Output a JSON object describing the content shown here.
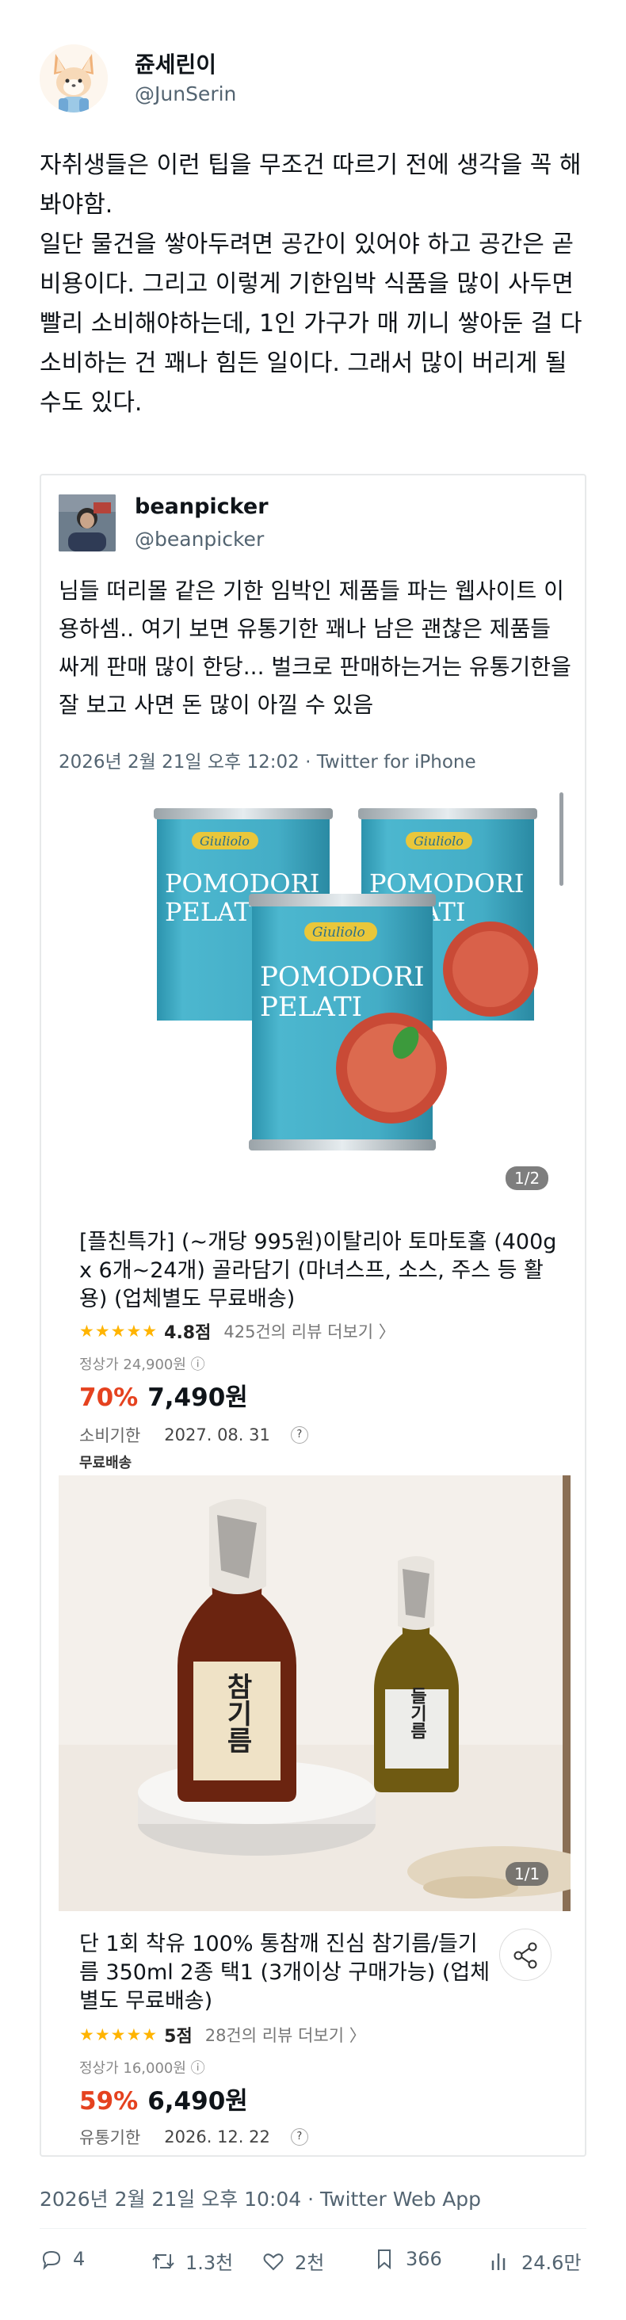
{
  "author": {
    "name": "쥰세린이",
    "handle": "@JunSerin"
  },
  "main_text": [
    "자취생들은 이런 팁을 무조건 따르기 전에 생각을 꼭 해봐야함.",
    "일단 물건을 쌓아두려면 공간이 있어야 하고 공간은 곧 비용이다. 그리고 이렇게 기한임박 식품을 많이 사두면 빨리 소비해야하는데, 1인 가구가 매 끼니 쌓아둔 걸 다 소비하는 건 꽤나 힘든 일이다. 그래서 많이 버리게 될 수도 있다."
  ],
  "quote": {
    "name": "beanpicker",
    "handle": "@beanpicker",
    "text": "님들 떠리몰 같은 기한 임박인 제품들 파는 웹사이트 이용하셈.. 여기 보면 유통기한 꽤나 남은 괜찮은 제품들 싸게 판매 많이 한당... 벌크로 판매하는거는 유통기한을 잘 보고 사면 돈 많이 아낄 수 있음",
    "date": "2026년 2월 21일 오후 12:02 · Twitter for iPhone"
  },
  "product1": {
    "can_brand": "Giuliolo",
    "can_label_line1": "POMODORI",
    "can_label_line2": "PELATI",
    "page_badge": "1/2",
    "title": "[플친특가] (~개당 995원)이탈리아 토마토홀 (400g x 6개~24개) 골라담기 (마녀스프, 소스, 주스 등 활용) (업체별도 무료배송)",
    "stars": "★★★★★",
    "rating": "4.8점",
    "reviews": "425건의 리뷰 더보기 〉",
    "list_price": "정상가 24,900원 ⓘ",
    "discount": "70%",
    "price": "7,490원",
    "expiry_label": "소비기한",
    "expiry_date": "2027. 08. 31",
    "help": "?",
    "free_shipping": "무료배송"
  },
  "product2": {
    "bottle1_label": "참기름",
    "bottle2_label": "들기름",
    "page_badge": "1/1",
    "title": "단 1회 착유 100% 통참깨 진심 참기름/들기름 350ml 2종 택1 (3개이상 구매가능) (업체별도 무료배송)",
    "stars": "★★★★★",
    "rating": "5점",
    "reviews": "28건의 리뷰 더보기 〉",
    "list_price": "정상가 16,000원 ⓘ",
    "discount": "59%",
    "price": "6,490원",
    "expiry_label": "유통기한",
    "expiry_date": "2026. 12. 22",
    "help": "?"
  },
  "post_date": "2026년 2월 21일 오후 10:04 · Twitter Web App",
  "actions": {
    "replies": "4",
    "retweets": "1.3천",
    "likes": "2천",
    "bookmarks": "366",
    "views": "24.6만"
  },
  "colors": {
    "discount": "#e5421f",
    "star": "#ffb400",
    "can_blue": "#3fa9c2",
    "muted_text": "#536471"
  }
}
